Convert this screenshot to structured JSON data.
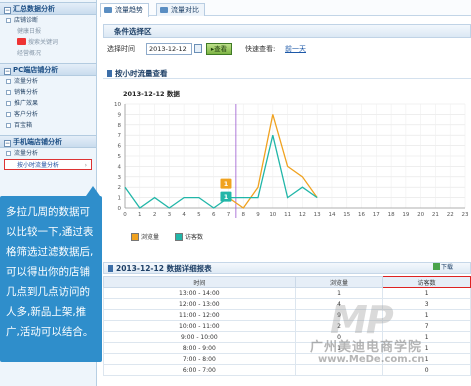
{
  "sidebar": {
    "sections": [
      {
        "title": "汇总数据分析",
        "items": [
          {
            "label": "店铺诊断"
          },
          {
            "label": "健康日报",
            "sub": true
          },
          {
            "label": "搜索关键词",
            "sub": true
          },
          {
            "label": "经营概况",
            "sub": true
          }
        ]
      },
      {
        "title": "PC端店铺分析",
        "items": [
          {
            "label": "流量分析"
          },
          {
            "label": "销售分析"
          },
          {
            "label": "推广效果"
          },
          {
            "label": "客户分析"
          },
          {
            "label": "百宝箱"
          }
        ]
      },
      {
        "title": "手机端店铺分析",
        "items": [
          {
            "label": "流量分析"
          },
          {
            "label": "按小时流量分析",
            "active": true
          }
        ]
      }
    ]
  },
  "tabs": [
    {
      "label": "流量趋势"
    },
    {
      "label": "流量对比"
    }
  ],
  "condition": {
    "title": "条件选择区",
    "time_label": "选择时间",
    "date_value": "2013-12-12",
    "query_label": "查看",
    "quick_label": "快速查看:",
    "quick_link": "前一天"
  },
  "chart_section": {
    "title": "按小时流量查看",
    "date_title": "2013-12-12 数据"
  },
  "chart_data": {
    "type": "line",
    "title": "2013-12-12 数据",
    "x": [
      0,
      1,
      2,
      3,
      4,
      5,
      6,
      7,
      8,
      9,
      10,
      11,
      12,
      13,
      14,
      15,
      16,
      17,
      18,
      19,
      20,
      21,
      22,
      23
    ],
    "ylim": [
      0,
      10
    ],
    "yticks": [
      0,
      1,
      2,
      3,
      4,
      5,
      6,
      7,
      8,
      9,
      10
    ],
    "marker_x": 7.5,
    "series": [
      {
        "name": "浏览量",
        "color": "#f0a21f",
        "points": [
          [
            7,
            1
          ],
          [
            8,
            0
          ],
          [
            9,
            2
          ],
          [
            10,
            9
          ],
          [
            11,
            4
          ],
          [
            12,
            3
          ],
          [
            13,
            1
          ]
        ]
      },
      {
        "name": "访客数",
        "color": "#21b6a8",
        "points": [
          [
            0,
            2
          ],
          [
            1,
            0
          ],
          [
            2,
            1
          ],
          [
            3,
            0
          ],
          [
            4,
            1
          ],
          [
            5,
            1
          ],
          [
            6,
            0
          ],
          [
            7,
            1
          ],
          [
            8,
            1
          ],
          [
            9,
            1
          ],
          [
            10,
            7
          ],
          [
            11,
            1
          ],
          [
            12,
            2
          ],
          [
            13,
            1
          ]
        ]
      }
    ],
    "tooltips": [
      {
        "x": 7,
        "y": 1,
        "text": "1",
        "color": "#f0a21f"
      },
      {
        "x": 7,
        "y": 1,
        "text": "1",
        "color": "#21b6a8"
      }
    ],
    "grid": true,
    "legend": "bottom-left"
  },
  "table_section": {
    "title": "2013-12-12 数据详细报表",
    "download": "下载",
    "headers": [
      "时间",
      "浏览量",
      "访客数"
    ],
    "rows": [
      [
        "13:00 - 14:00",
        "1",
        "1"
      ],
      [
        "12:00 - 13:00",
        "4",
        "3"
      ],
      [
        "11:00 - 12:00",
        "9",
        "1"
      ],
      [
        "10:00 - 11:00",
        "2",
        "7"
      ],
      [
        "9:00 - 10:00",
        "0",
        "1"
      ],
      [
        "8:00 - 9:00",
        "1",
        "1"
      ],
      [
        "7:00 - 8:00",
        "",
        "1"
      ],
      [
        "6:00 - 7:00",
        "",
        "0"
      ]
    ]
  },
  "callout": {
    "text": "多拉几周的数据可以比较一下,通过表格筛选过滤数据后,可以得出你的店铺几点到几点访问的人多,新品上架,推广,活动可以结合。"
  },
  "watermark": {
    "logo": "MP",
    "name": "广州美迪电商学院",
    "url": "www.MeDe.com.cn"
  },
  "colors": {
    "accent": "#2f8ecb",
    "pv_line": "#f0a21f",
    "uv_line": "#21b6a8"
  }
}
